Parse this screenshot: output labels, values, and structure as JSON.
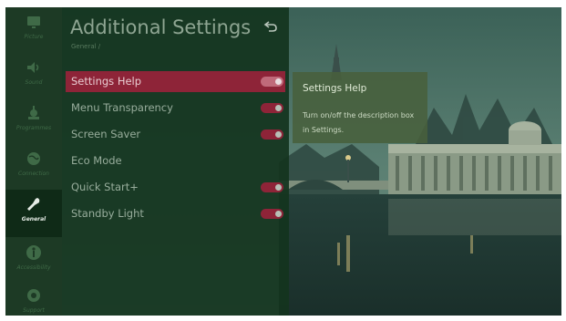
{
  "rail": {
    "items": [
      {
        "label": "Picture",
        "icon": "picture-icon"
      },
      {
        "label": "Sound",
        "icon": "speaker-icon"
      },
      {
        "label": "Programmes",
        "icon": "antenna-icon"
      },
      {
        "label": "Connection",
        "icon": "globe-icon"
      },
      {
        "label": "General",
        "icon": "wrench-icon",
        "active": true
      },
      {
        "label": "Accessibility",
        "icon": "accessibility-icon"
      },
      {
        "label": "Support",
        "icon": "support-icon"
      }
    ]
  },
  "panel": {
    "title": "Additional Settings",
    "breadcrumb": "General /",
    "back_icon": "back-arrow-icon",
    "items": [
      {
        "label": "Settings Help",
        "toggle": true,
        "selected": true
      },
      {
        "label": "Menu Transparency",
        "toggle": true
      },
      {
        "label": "Screen Saver",
        "toggle": true
      },
      {
        "label": "Eco Mode",
        "toggle": false
      },
      {
        "label": "Quick Start+",
        "toggle": true
      },
      {
        "label": "Standby Light",
        "toggle": true
      }
    ]
  },
  "help": {
    "title": "Settings Help",
    "text": "Turn on/off the description box in Settings."
  },
  "colors": {
    "accent": "#8e2438",
    "rail": "#1d3a25",
    "panel": "#14341e"
  }
}
